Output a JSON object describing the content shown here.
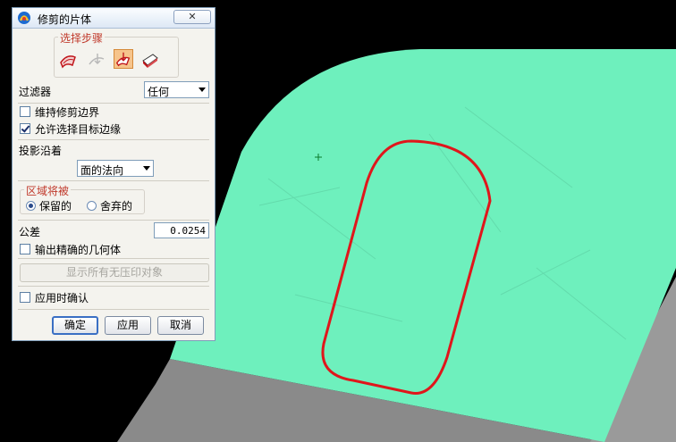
{
  "dialog": {
    "title": "修剪的片体",
    "close_glyph": "✕",
    "steps": {
      "legend": "选择步骤",
      "icons": [
        "target-sheet-icon",
        "boundary-object-icon",
        "projection-direction-icon",
        "region-icon"
      ],
      "active_index": 2
    },
    "filter": {
      "label": "过滤器",
      "value": "任何"
    },
    "keep_trim_boundary": {
      "label": "维持修剪边界",
      "checked": false
    },
    "allow_target_edge": {
      "label": "允许选择目标边缘",
      "checked": true
    },
    "projection": {
      "label": "投影沿着",
      "value": "面的法向"
    },
    "region": {
      "legend": "区域将被",
      "keep_label": "保留的",
      "discard_label": "舍弃的",
      "selected": "keep"
    },
    "tolerance": {
      "label": "公差",
      "value": "0.0254"
    },
    "output_exact": {
      "label": "输出精确的几何体",
      "checked": false
    },
    "show_unimprinted_button": "显示所有无压印对象",
    "confirm_on_apply": {
      "label": "应用时确认",
      "checked": false
    },
    "buttons": {
      "ok": "确定",
      "apply": "应用",
      "cancel": "取消"
    }
  },
  "colors": {
    "surface": "#6ef0bd",
    "side_wall": "#8c8c8c",
    "trim_curve": "#e0161b",
    "background": "#000000"
  }
}
